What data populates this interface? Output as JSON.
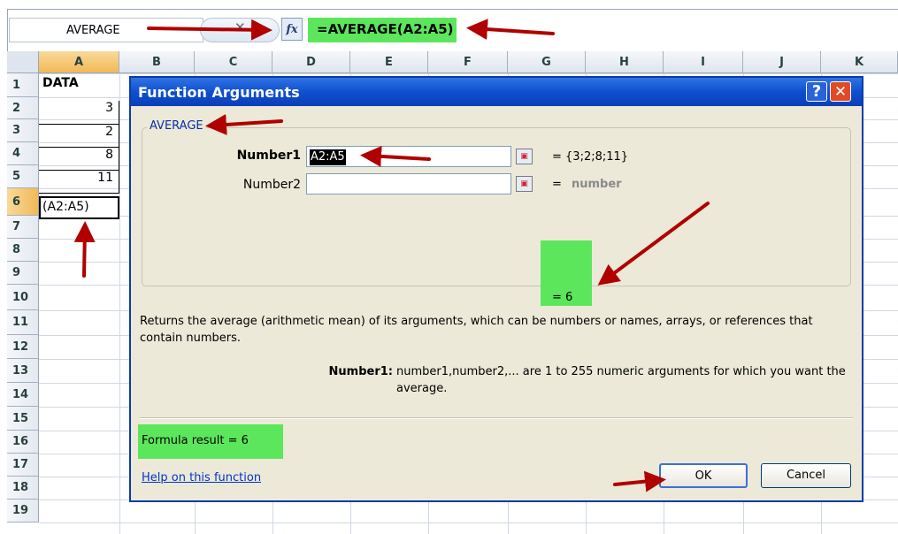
{
  "formula_bar": {
    "name_box": "AVERAGE",
    "cancel_glyph": "✕",
    "fx_label": "fx",
    "formula": "=AVERAGE(A2:A5)"
  },
  "columns": [
    "A",
    "B",
    "C",
    "D",
    "E",
    "F",
    "G",
    "H",
    "I",
    "J",
    "K"
  ],
  "rows": [
    "1",
    "2",
    "3",
    "4",
    "5",
    "6",
    "7",
    "8",
    "9",
    "10",
    "11",
    "12",
    "13",
    "14",
    "15",
    "16",
    "17",
    "18",
    "19"
  ],
  "column_a": {
    "r1": "DATA",
    "r2": "3",
    "r3": "2",
    "r4": "8",
    "r5": "11",
    "r6": "(A2:A5)"
  },
  "dialog": {
    "title": "Function Arguments",
    "help_glyph": "?",
    "close_glyph": "✕",
    "function_name": "AVERAGE",
    "arg1_label": "Number1",
    "arg1_value": "A2:A5",
    "arg1_result": "=   {3;2;8;11}",
    "arg2_label": "Number2",
    "arg2_value": "",
    "arg2_result_eq": "=",
    "arg2_result": "number",
    "result": "=  6",
    "description": "Returns the average (arithmetic mean) of its arguments, which can be numbers or names, arrays, or references that contain numbers.",
    "arg_help_label": "Number1:",
    "arg_help_text": "number1,number2,... are 1 to 255 numeric arguments for which you want the average.",
    "formula_result": "Formula result =   6",
    "help_link": "Help on this function",
    "ok_label": "OK",
    "cancel_label": "Cancel"
  },
  "colors": {
    "highlight_green": "#5ce65c",
    "arrow_red": "#b00000",
    "titlebar_blue": "#0f4fd0"
  }
}
